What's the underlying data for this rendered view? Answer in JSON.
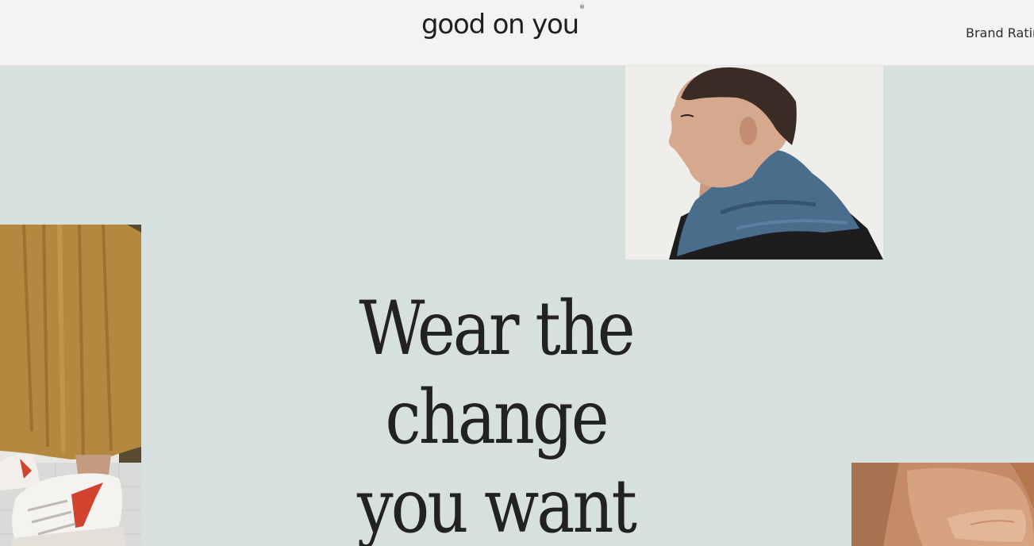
{
  "header": {
    "logo": "good on you",
    "logo_mark": "®",
    "nav": {
      "brand_ratings": "Brand Ratings"
    }
  },
  "hero": {
    "headline_lines": [
      "Wear the",
      "change",
      "you want"
    ]
  },
  "images": [
    {
      "name": "man-with-blue-scarf-photo"
    },
    {
      "name": "trousers-and-sneakers-photo"
    },
    {
      "name": "bare-shoulder-photo"
    }
  ],
  "colors": {
    "header_bg": "#f4f3f1",
    "hero_bg": "#d6e1df",
    "text": "#222222"
  }
}
